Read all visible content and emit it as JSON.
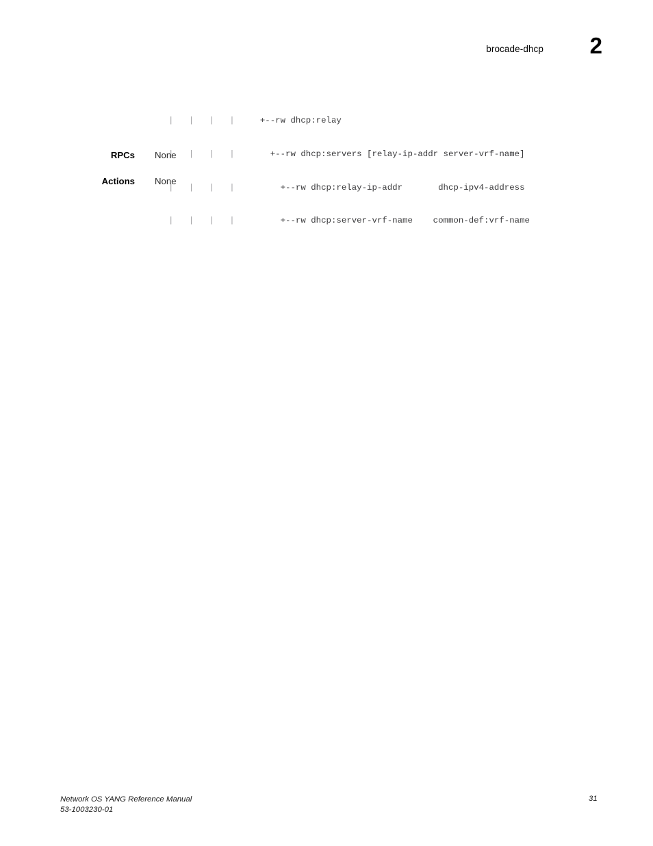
{
  "header": {
    "title": "brocade-dhcp",
    "chapter_number": "2"
  },
  "code_block": {
    "language": "yang-tree",
    "lines": [
      {
        "guide": "|   |   |   |   ",
        "content": "  +--rw dhcp:relay"
      },
      {
        "guide": "|   |   |   |   ",
        "content": "    +--rw dhcp:servers [relay-ip-addr server-vrf-name]"
      },
      {
        "guide": "|   |   |   |   ",
        "content": "      +--rw dhcp:relay-ip-addr       dhcp-ipv4-address"
      },
      {
        "guide": "|   |   |   |   ",
        "content": "      +--rw dhcp:server-vrf-name    common-def:vrf-name"
      }
    ]
  },
  "definitions": [
    {
      "label": "RPCs",
      "value": "None"
    },
    {
      "label": "Actions",
      "value": "None"
    }
  ],
  "footer": {
    "manual_title": "Network OS YANG Reference Manual",
    "document_number": "53-1003230-01",
    "page_number": "31"
  },
  "colors": {
    "page_background": "#ffffff",
    "body_text": "#000000",
    "code_text": "#39393b",
    "tree_guide": "#a2a2a4",
    "footer_text": "#1a1a1a"
  }
}
